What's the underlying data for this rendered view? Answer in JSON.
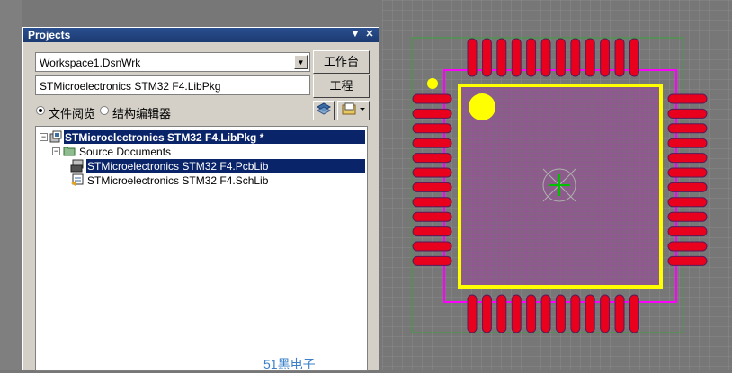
{
  "panel": {
    "title": "Projects",
    "pin_glyph": "▼",
    "close_glyph": "✕",
    "workspace_combo": "Workspace1.DsnWrk",
    "workspace_button": "工作台",
    "project_field": "STMicroelectronics STM32 F4.LibPkg",
    "project_button": "工程",
    "view_options": [
      {
        "label": "文件阅览",
        "selected": true
      },
      {
        "label": "结构编辑器",
        "selected": false
      }
    ]
  },
  "tree": {
    "project": "STMicroelectronics STM32 F4.LibPkg *",
    "folder": "Source Documents",
    "documents": [
      {
        "name": "STMicroelectronics STM32 F4.PcbLib",
        "selected": true
      },
      {
        "name": "STMicroelectronics STM32 F4.SchLib",
        "selected": false
      }
    ]
  },
  "watermark": "51黑电子",
  "colors": {
    "pad": "#e8001c",
    "silkscreen": "#ffff00",
    "courtyard": "#ff00ff",
    "grid": "#909090",
    "background": "#777777",
    "outline": "#3aa13a"
  }
}
